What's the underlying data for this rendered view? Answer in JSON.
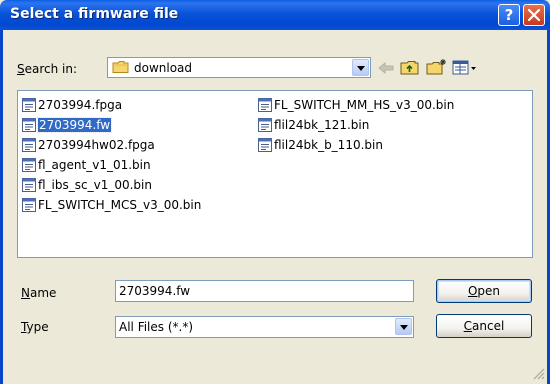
{
  "window": {
    "title": "Select a firmware file",
    "help_button": "?",
    "close_button": "X"
  },
  "search_in": {
    "label_key": "S",
    "label_rest": "earch in:",
    "value": "download"
  },
  "toolbar": {
    "icons": [
      "back-arrow-icon",
      "up-folder-icon",
      "new-folder-icon",
      "view-menu-icon"
    ]
  },
  "files": {
    "column1": [
      {
        "name": "2703994.fpga"
      },
      {
        "name": "2703994.fw",
        "selected": true
      },
      {
        "name": "2703994hw02.fpga"
      },
      {
        "name": "fl_agent_v1_01.bin"
      },
      {
        "name": "fl_ibs_sc_v1_00.bin"
      },
      {
        "name": "FL_SWITCH_MCS_v3_00.bin"
      }
    ],
    "column2": [
      {
        "name": "FL_SWITCH_MM_HS_v3_00.bin"
      },
      {
        "name": "flil24bk_121.bin"
      },
      {
        "name": "flil24bk_b_110.bin"
      }
    ]
  },
  "name_field": {
    "label_key": "N",
    "label_rest": "ame",
    "value": "2703994.fw"
  },
  "type_field": {
    "label_key": "T",
    "label_rest": "ype",
    "value": "All Files (*.*)"
  },
  "buttons": {
    "open_key": "O",
    "open_rest": "pen",
    "cancel_key": "C",
    "cancel_rest": "ancel"
  },
  "colors": {
    "titlebar": "#0853d8",
    "selection": "#316ac5",
    "dialog_bg": "#ece9d8"
  }
}
